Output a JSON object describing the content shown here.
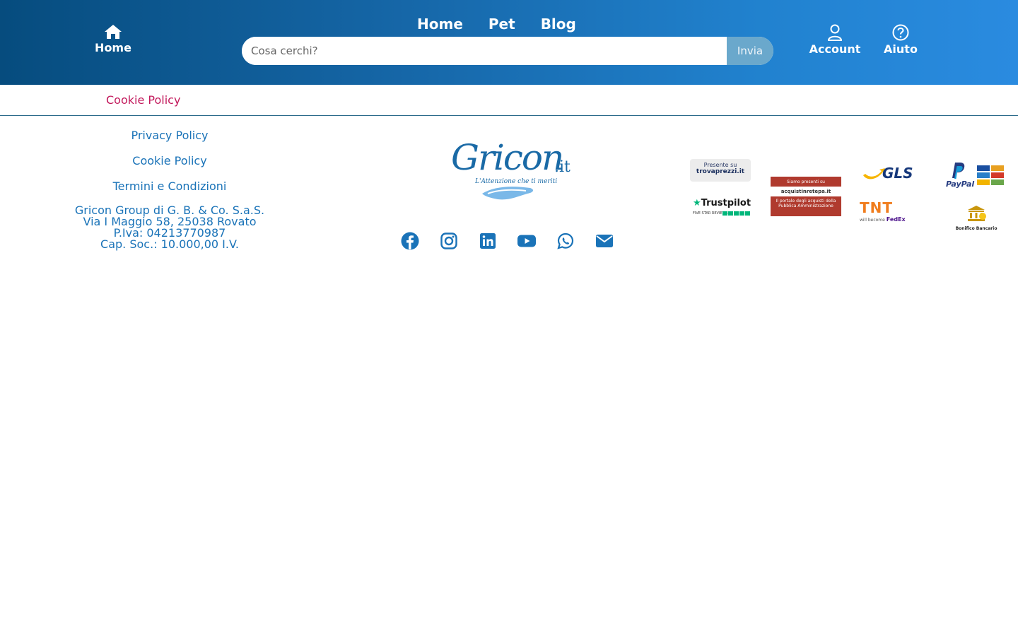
{
  "header": {
    "home_label": "Home",
    "top_links": [
      "Home",
      "Pet",
      "Blog"
    ],
    "search_placeholder": "Cosa cerchi?",
    "search_button": "Invia",
    "account_label": "Account",
    "help_label": "Aiuto"
  },
  "breadcrumb": {
    "current": "Cookie Policy"
  },
  "footer": {
    "links": [
      "Privacy Policy",
      "Cookie Policy",
      "Termini e Condizioni"
    ],
    "company": [
      "Gricon Group di G. B. & Co. S.a.S.",
      "Via I Maggio 58, 25038 Rovato",
      "P.Iva: 04213770987",
      "Cap. Soc.: 10.000,00 I.V."
    ],
    "logo": {
      "word": "Gricon",
      "suffix": ".it",
      "tagline": "L'Attenzione che ti meriti"
    },
    "social_icons": [
      "facebook-icon",
      "instagram-icon",
      "linkedin-icon",
      "youtube-icon",
      "whatsapp-icon",
      "email-icon"
    ],
    "badges": {
      "trovaprezzi_top": "Presente su",
      "trovaprezzi_name": "trovaprezzi.it",
      "acquisti_top": "Siamo presenti su",
      "acquisti_name": "acquistinretepa.it",
      "acquisti_bottom": "Il portale degli acquisti della Pubblica Amministrazione",
      "gls": "GLS",
      "paypal": "PayPal",
      "trustpilot": "Trustpilot",
      "trustpilot_sub": "FIVE STAR REVIEWS",
      "tnt": "TNT",
      "tnt_sub": "will become",
      "tnt_fedex": "FedEx",
      "bonifico": "Bonifico Bancario"
    }
  },
  "colors": {
    "header_start": "#064c7e",
    "header_end": "#2a8be0",
    "link": "#1a73b8",
    "breadcrumb": "#c2185b"
  }
}
